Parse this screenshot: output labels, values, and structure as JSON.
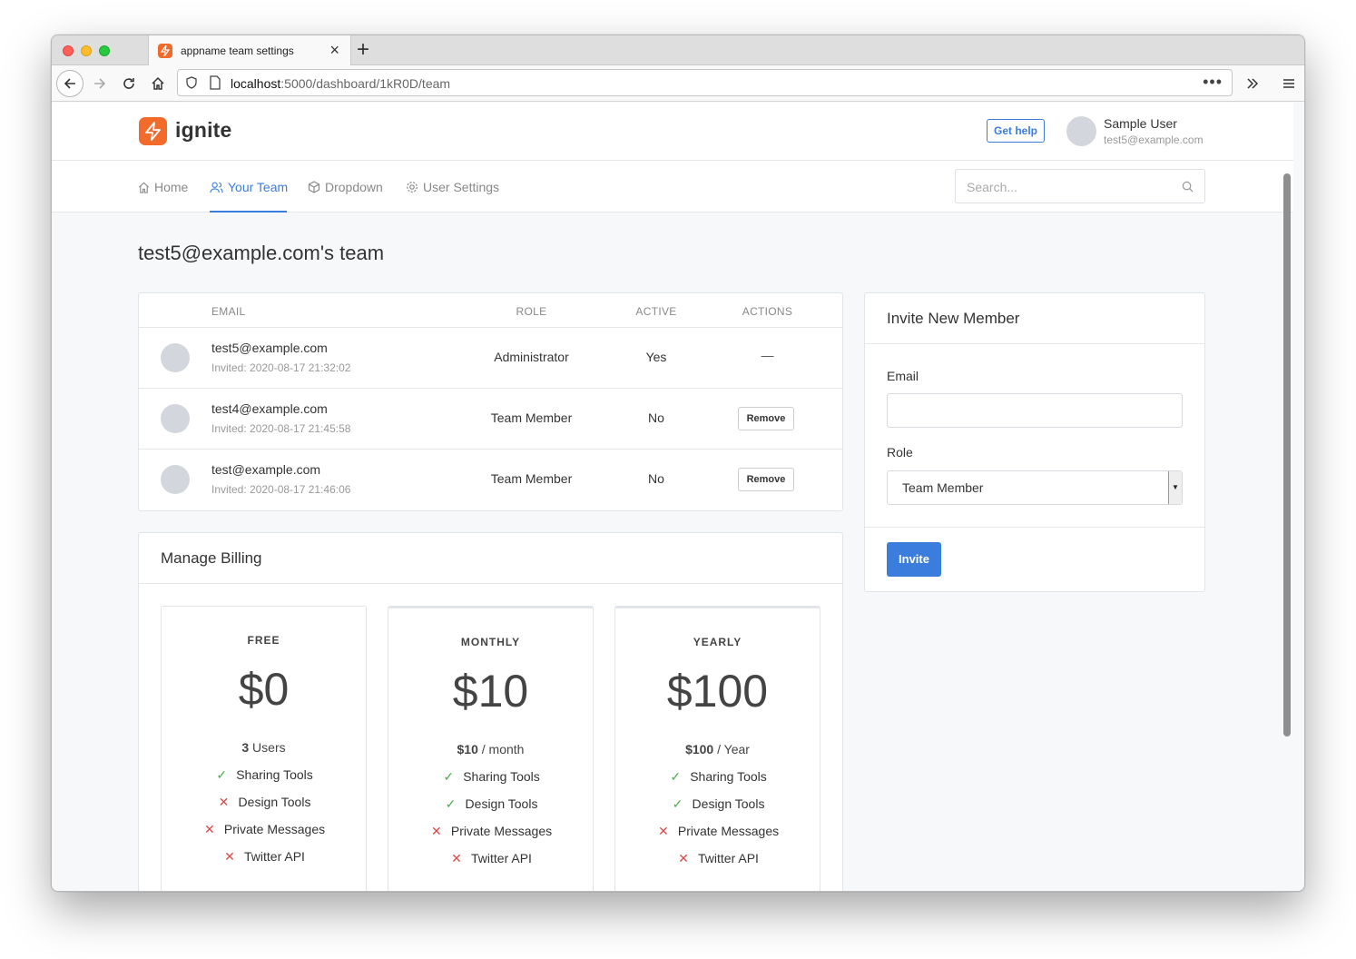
{
  "browser": {
    "tab_title": "appname team settings",
    "url_host": "localhost",
    "url_path": ":5000/dashboard/1kR0D/team"
  },
  "header": {
    "logo": "ignite",
    "help_label": "Get help",
    "user_name": "Sample User",
    "user_email": "test5@example.com"
  },
  "nav": {
    "items": [
      {
        "label": "Home"
      },
      {
        "label": "Your Team"
      },
      {
        "label": "Dropdown"
      },
      {
        "label": "User Settings"
      }
    ],
    "search_placeholder": "Search..."
  },
  "team": {
    "title": "test5@example.com's team",
    "columns": [
      "EMAIL",
      "ROLE",
      "ACTIVE",
      "ACTIONS"
    ],
    "members": [
      {
        "email": "test5@example.com",
        "invited": "Invited: 2020-08-17 21:32:02",
        "role": "Administrator",
        "active": "Yes",
        "action": "—"
      },
      {
        "email": "test4@example.com",
        "invited": "Invited: 2020-08-17 21:45:58",
        "role": "Team Member",
        "active": "No",
        "action": "Remove"
      },
      {
        "email": "test@example.com",
        "invited": "Invited: 2020-08-17 21:46:06",
        "role": "Team Member",
        "active": "No",
        "action": "Remove"
      }
    ]
  },
  "billing": {
    "title": "Manage Billing",
    "plans": [
      {
        "name": "FREE",
        "price": "$0",
        "sub_bold": "3",
        "sub_rest": " Users",
        "features": [
          [
            "ok",
            "Sharing Tools"
          ],
          [
            "no",
            "Design Tools"
          ],
          [
            "no",
            "Private Messages"
          ],
          [
            "no",
            "Twitter API"
          ]
        ]
      },
      {
        "name": "MONTHLY",
        "price": "$10",
        "sub_bold": "$10",
        "sub_rest": " / month",
        "features": [
          [
            "ok",
            "Sharing Tools"
          ],
          [
            "ok",
            "Design Tools"
          ],
          [
            "no",
            "Private Messages"
          ],
          [
            "no",
            "Twitter API"
          ]
        ]
      },
      {
        "name": "YEARLY",
        "price": "$100",
        "sub_bold": "$100",
        "sub_rest": " / Year",
        "features": [
          [
            "ok",
            "Sharing Tools"
          ],
          [
            "ok",
            "Design Tools"
          ],
          [
            "no",
            "Private Messages"
          ],
          [
            "no",
            "Twitter API"
          ]
        ]
      }
    ]
  },
  "invite": {
    "title": "Invite New Member",
    "email_label": "Email",
    "email_value": "",
    "role_label": "Role",
    "role_value": "Team Member",
    "button": "Invite"
  },
  "colors": {
    "accent": "#3b7ddd",
    "brand": "#f26b2a",
    "ok": "#4ab14a",
    "no": "#e04848"
  }
}
